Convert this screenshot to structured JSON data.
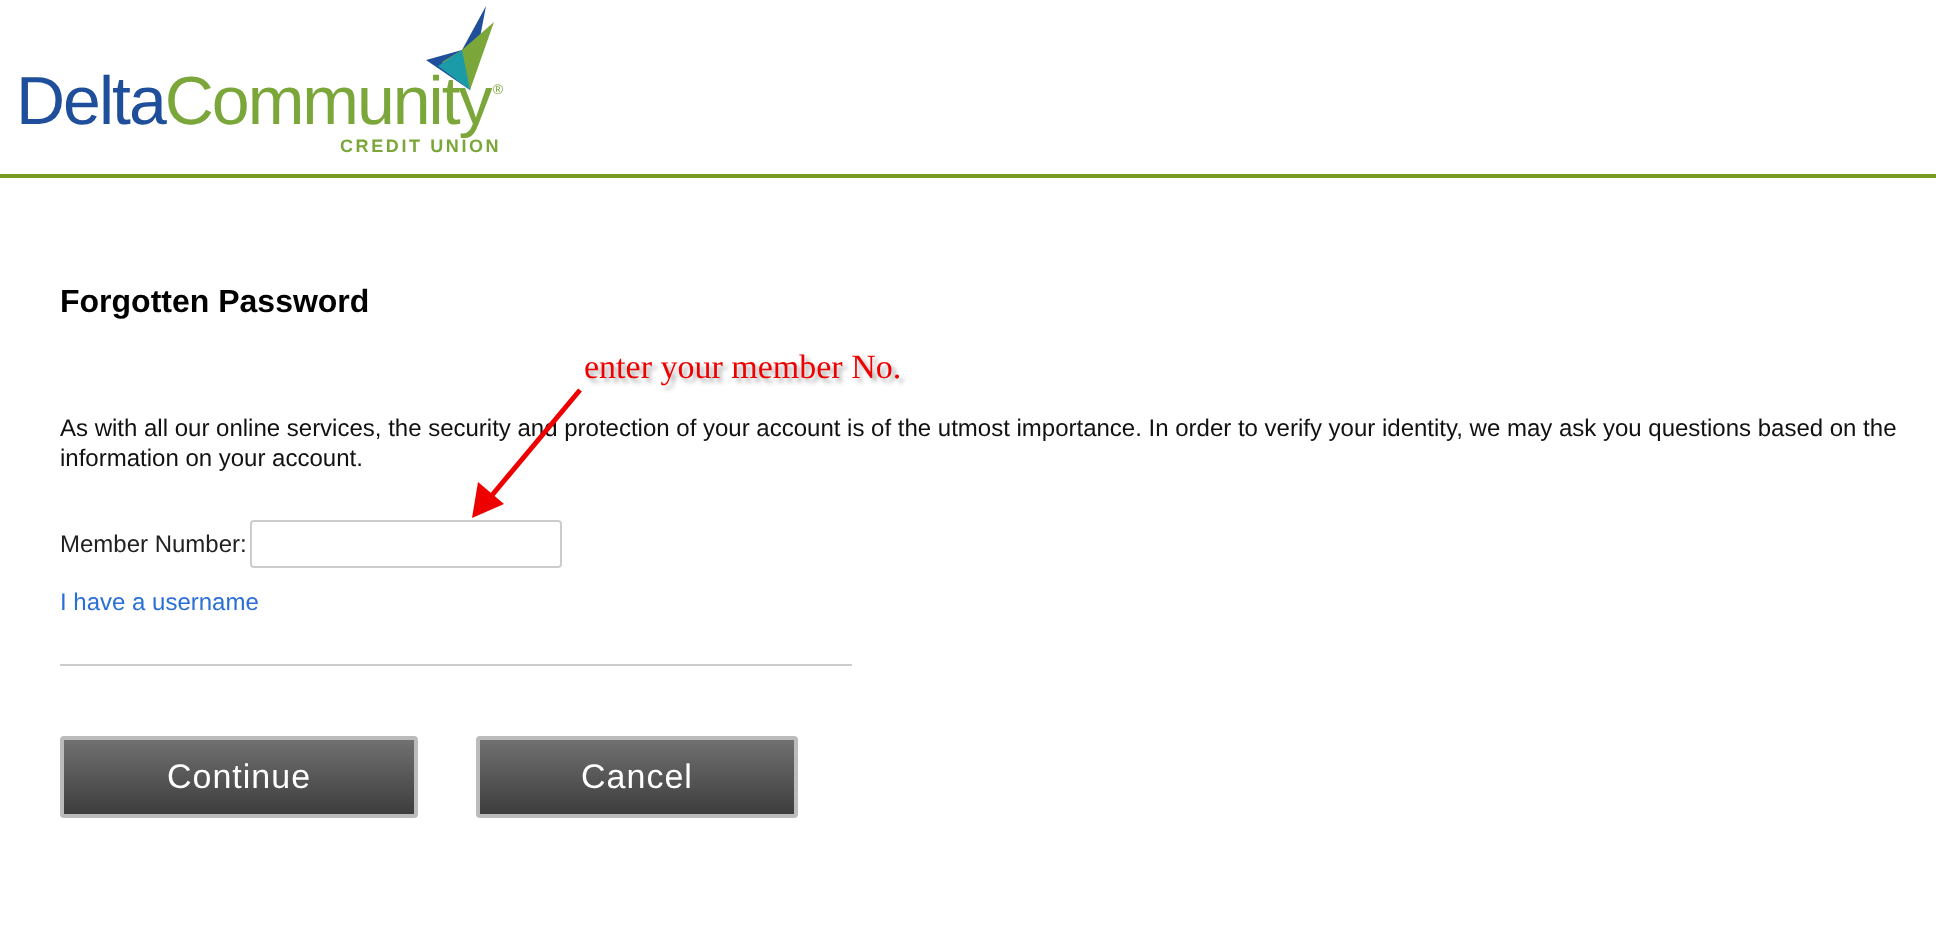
{
  "logo": {
    "word_1": "Delta",
    "word_2": "Community",
    "mark": "®",
    "tagline": "CREDIT UNION"
  },
  "title": "Forgotten Password",
  "annotation": "enter your member No.",
  "intro": "As with all our online services, the security and protection of your account is of the utmost importance. In order to verify your identity, we may ask you questions based on the information on your account.",
  "member_field": {
    "label": "Member Number:"
  },
  "username_link": "I have a username",
  "buttons": [
    "Continue",
    "Cancel"
  ]
}
